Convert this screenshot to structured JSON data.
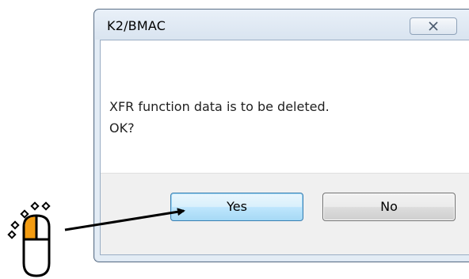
{
  "dialog": {
    "title": "K2/BMAC",
    "message_lines": [
      "XFR function data is to be deleted.",
      "OK?"
    ],
    "buttons": {
      "yes_label": "Yes",
      "no_label": "No"
    }
  },
  "illustration": {
    "mouse_icon": "mouse-left-click-icon",
    "arrow_icon": "pointer-arrow-icon",
    "highlight_color": "#f39c12"
  },
  "colors": {
    "default_button_border": "#3c7fb1",
    "title_bar": "#d9e4f0"
  }
}
